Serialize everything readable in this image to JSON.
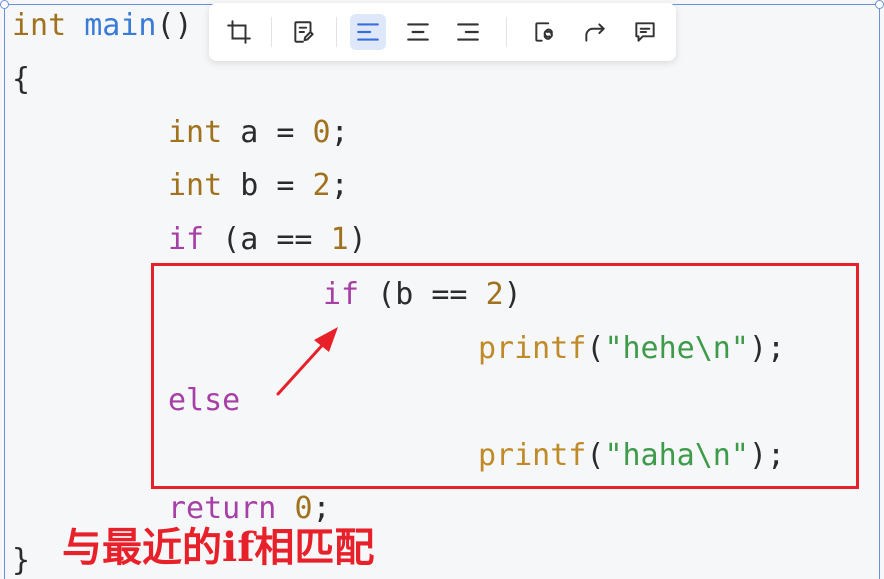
{
  "code": {
    "line1": {
      "type": "int",
      "fn": "main",
      "parens": "()"
    },
    "line2": {
      "brace": "{"
    },
    "line3": {
      "type": "int",
      "rest1": " a = ",
      "num": "0",
      "rest2": ";"
    },
    "line4": {
      "type": "int",
      "rest1": " b = ",
      "num": "2",
      "rest2": ";"
    },
    "line5": {
      "kw": "if",
      "rest1": " (a == ",
      "num": "1",
      "rest2": ")"
    },
    "line6": {
      "kw": "if",
      "rest1": " (b == ",
      "num": "2",
      "rest2": ")"
    },
    "line7": {
      "fn": "printf",
      "open": "(",
      "str": "\"hehe\\n\"",
      "close": ");"
    },
    "line8": {
      "kw": "else"
    },
    "line9": {
      "fn": "printf",
      "open": "(",
      "str": "\"haha\\n\"",
      "close": ");"
    },
    "line10": {
      "kw": "return",
      "sp": " ",
      "num": "0",
      "rest": ";"
    },
    "line11": {
      "brace": "}"
    }
  },
  "annotation": {
    "text": "与最近的if相匹配"
  },
  "toolbar": {
    "buttons": [
      {
        "icon": "crop-icon"
      },
      {
        "icon": "edit-note-icon"
      },
      {
        "icon": "align-left-icon",
        "active": true
      },
      {
        "icon": "align-center-icon"
      },
      {
        "icon": "align-right-icon"
      },
      {
        "icon": "link-icon"
      },
      {
        "icon": "share-icon"
      },
      {
        "icon": "comment-icon"
      }
    ]
  },
  "colors": {
    "accent": "#6f8fd6",
    "highlight": "#e8202a",
    "keyword": "#a63fa6",
    "type": "#a0721e",
    "string": "#3d9b4a",
    "function": "#3a7bd5",
    "active_button": "#dfe8fb"
  }
}
